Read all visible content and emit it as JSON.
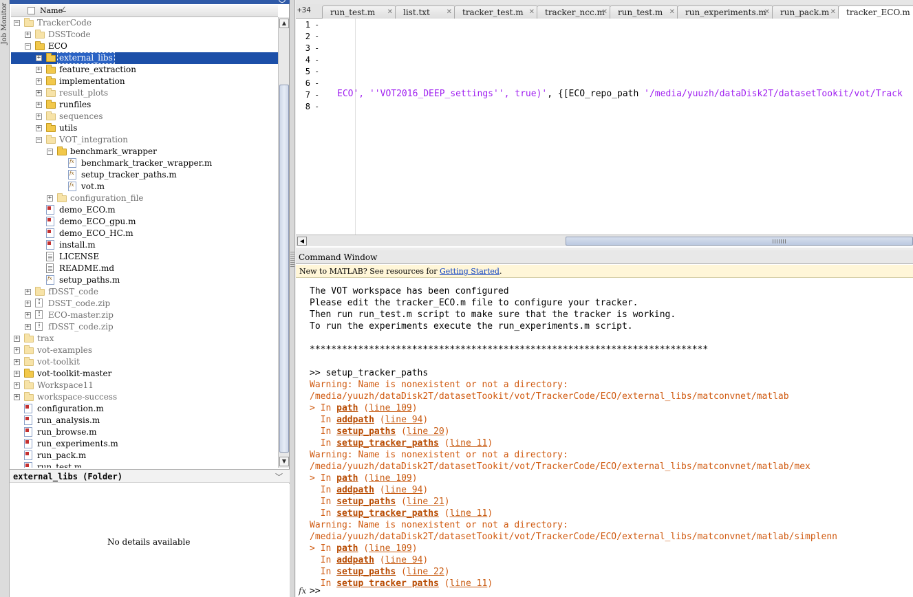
{
  "job_monitor": {
    "label": "Job Monitor"
  },
  "folder_panel": {
    "header_col": "Name",
    "sort_indicator": "∠",
    "tree": [
      {
        "label": "TrackerCode",
        "kind": "folder",
        "depth": 0,
        "expander": "⊟",
        "dim": true
      },
      {
        "label": "DSSTcode",
        "kind": "folder",
        "depth": 1,
        "expander": "⊞",
        "dim": true
      },
      {
        "label": "ECO",
        "kind": "folder",
        "depth": 1,
        "expander": "⊟",
        "dim": false
      },
      {
        "label": "external_libs",
        "kind": "folder",
        "depth": 2,
        "expander": "⊞",
        "dim": false,
        "selected": true
      },
      {
        "label": "feature_extraction",
        "kind": "folder",
        "depth": 2,
        "expander": "⊞",
        "dim": false
      },
      {
        "label": "implementation",
        "kind": "folder",
        "depth": 2,
        "expander": "⊞",
        "dim": false
      },
      {
        "label": "result_plots",
        "kind": "folder",
        "depth": 2,
        "expander": "⊞",
        "dim": true
      },
      {
        "label": "runfiles",
        "kind": "folder",
        "depth": 2,
        "expander": "⊞",
        "dim": false
      },
      {
        "label": "sequences",
        "kind": "folder",
        "depth": 2,
        "expander": "⊞",
        "dim": true
      },
      {
        "label": "utils",
        "kind": "folder",
        "depth": 2,
        "expander": "⊞",
        "dim": false
      },
      {
        "label": "VOT_integration",
        "kind": "folder",
        "depth": 2,
        "expander": "⊟",
        "dim": true
      },
      {
        "label": "benchmark_wrapper",
        "kind": "folder",
        "depth": 3,
        "expander": "⊟",
        "dim": false
      },
      {
        "label": "benchmark_tracker_wrapper.m",
        "kind": "fx",
        "depth": 4,
        "expander": "",
        "dim": false
      },
      {
        "label": "setup_tracker_paths.m",
        "kind": "fx",
        "depth": 4,
        "expander": "",
        "dim": false
      },
      {
        "label": "vot.m",
        "kind": "fx",
        "depth": 4,
        "expander": "",
        "dim": false
      },
      {
        "label": "configuration_file",
        "kind": "folder",
        "depth": 3,
        "expander": "⊞",
        "dim": true
      },
      {
        "label": "demo_ECO.m",
        "kind": "m",
        "depth": 2,
        "expander": "",
        "dim": false
      },
      {
        "label": "demo_ECO_gpu.m",
        "kind": "m",
        "depth": 2,
        "expander": "",
        "dim": false
      },
      {
        "label": "demo_ECO_HC.m",
        "kind": "m",
        "depth": 2,
        "expander": "",
        "dim": false
      },
      {
        "label": "install.m",
        "kind": "m",
        "depth": 2,
        "expander": "",
        "dim": false
      },
      {
        "label": "LICENSE",
        "kind": "txt",
        "depth": 2,
        "expander": "",
        "dim": false
      },
      {
        "label": "README.md",
        "kind": "txt",
        "depth": 2,
        "expander": "",
        "dim": false
      },
      {
        "label": "setup_paths.m",
        "kind": "fx",
        "depth": 2,
        "expander": "",
        "dim": false
      },
      {
        "label": "fDSST_code",
        "kind": "folder",
        "depth": 1,
        "expander": "⊞",
        "dim": true
      },
      {
        "label": "DSST_code.zip",
        "kind": "zip",
        "depth": 1,
        "expander": "⊞",
        "dim": true
      },
      {
        "label": "ECO-master.zip",
        "kind": "zip",
        "depth": 1,
        "expander": "⊞",
        "dim": true
      },
      {
        "label": "fDSST_code.zip",
        "kind": "zip",
        "depth": 1,
        "expander": "⊞",
        "dim": true
      },
      {
        "label": "trax",
        "kind": "folder",
        "depth": 0,
        "expander": "⊞",
        "dim": true
      },
      {
        "label": "vot-examples",
        "kind": "folder",
        "depth": 0,
        "expander": "⊞",
        "dim": true
      },
      {
        "label": "vot-toolkit",
        "kind": "folder",
        "depth": 0,
        "expander": "⊞",
        "dim": true
      },
      {
        "label": "vot-toolkit-master",
        "kind": "folder",
        "depth": 0,
        "expander": "⊞",
        "dim": false
      },
      {
        "label": "Workspace11",
        "kind": "folder",
        "depth": 0,
        "expander": "⊞",
        "dim": true
      },
      {
        "label": "workspace-success",
        "kind": "folder",
        "depth": 0,
        "expander": "⊞",
        "dim": true
      },
      {
        "label": "configuration.m",
        "kind": "m",
        "depth": 0,
        "expander": "",
        "dim": false
      },
      {
        "label": "run_analysis.m",
        "kind": "m",
        "depth": 0,
        "expander": "",
        "dim": false
      },
      {
        "label": "run_browse.m",
        "kind": "m",
        "depth": 0,
        "expander": "",
        "dim": false
      },
      {
        "label": "run_experiments.m",
        "kind": "m",
        "depth": 0,
        "expander": "",
        "dim": false
      },
      {
        "label": "run_pack.m",
        "kind": "m",
        "depth": 0,
        "expander": "",
        "dim": false
      },
      {
        "label": "run_test.m",
        "kind": "m",
        "depth": 0,
        "expander": "",
        "dim": false
      }
    ],
    "details": {
      "title": "external_libs  (Folder)",
      "empty_text": "No details available",
      "chevron": "﹀"
    }
  },
  "editor": {
    "overflow_label": "+34",
    "tabs": [
      {
        "label": "run_test.m",
        "active": false
      },
      {
        "label": "list.txt",
        "active": false
      },
      {
        "label": "tracker_test.m",
        "active": false
      },
      {
        "label": "tracker_ncc.m",
        "active": false
      },
      {
        "label": "run_test.m",
        "active": false
      },
      {
        "label": "run_experiments.m",
        "active": false
      },
      {
        "label": "run_pack.m",
        "active": false
      },
      {
        "label": "tracker_ECO.m",
        "active": true
      }
    ],
    "lines": [
      "1",
      "2",
      "3",
      "4",
      "5",
      "6",
      "7",
      "8"
    ],
    "line7": {
      "s1": "ECO', ''VOT2016_DEEP_settings'', true)'",
      "s2": ", {[ECO_repo_path ",
      "s3": "'/media/yuuzh/dataDisk2T/datasetTookit/vot/Track"
    }
  },
  "command_window": {
    "title": "Command Window",
    "info_prefix": "New to MATLAB? See resources for ",
    "info_link": "Getting Started",
    "info_suffix": ".",
    "output": [
      "The VOT workspace has been configured",
      "Please edit the tracker_ECO.m file to configure your tracker.",
      "Then run run_test.m script to make sure that the tracker is working.",
      "To run the experiments execute the run_experiments.m script.",
      "",
      "**************************************************************************",
      "",
      ">> setup_tracker_paths"
    ],
    "warnings": [
      {
        "msg": "Warning: Name is nonexistent or not a directory:",
        "path": "/media/yuuzh/dataDisk2T/datasetTookit/vot/TrackerCode/ECO/external_libs/matconvnet/matlab",
        "trace": [
          {
            "prefix": "> In ",
            "fn": "path",
            "ln": "line 109"
          },
          {
            "prefix": "  In ",
            "fn": "addpath",
            "ln": "line 94"
          },
          {
            "prefix": "  In ",
            "fn": "setup_paths",
            "ln": "line 20"
          },
          {
            "prefix": "  In ",
            "fn": "setup_tracker_paths",
            "ln": "line 11"
          }
        ]
      },
      {
        "msg": "Warning: Name is nonexistent or not a directory:",
        "path": "/media/yuuzh/dataDisk2T/datasetTookit/vot/TrackerCode/ECO/external_libs/matconvnet/matlab/mex",
        "trace": [
          {
            "prefix": "> In ",
            "fn": "path",
            "ln": "line 109"
          },
          {
            "prefix": "  In ",
            "fn": "addpath",
            "ln": "line 94"
          },
          {
            "prefix": "  In ",
            "fn": "setup_paths",
            "ln": "line 21"
          },
          {
            "prefix": "  In ",
            "fn": "setup_tracker_paths",
            "ln": "line 11"
          }
        ]
      },
      {
        "msg": "Warning: Name is nonexistent or not a directory:",
        "path": "/media/yuuzh/dataDisk2T/datasetTookit/vot/TrackerCode/ECO/external_libs/matconvnet/matlab/simplenn",
        "trace": [
          {
            "prefix": "> In ",
            "fn": "path",
            "ln": "line 109"
          },
          {
            "prefix": "  In ",
            "fn": "addpath",
            "ln": "line 94"
          },
          {
            "prefix": "  In ",
            "fn": "setup_paths",
            "ln": "line 22"
          },
          {
            "prefix": "  In ",
            "fn": "setup_tracker_paths",
            "ln": "line 11"
          }
        ]
      }
    ],
    "fx_label": "fx",
    "prompt": ">>"
  }
}
